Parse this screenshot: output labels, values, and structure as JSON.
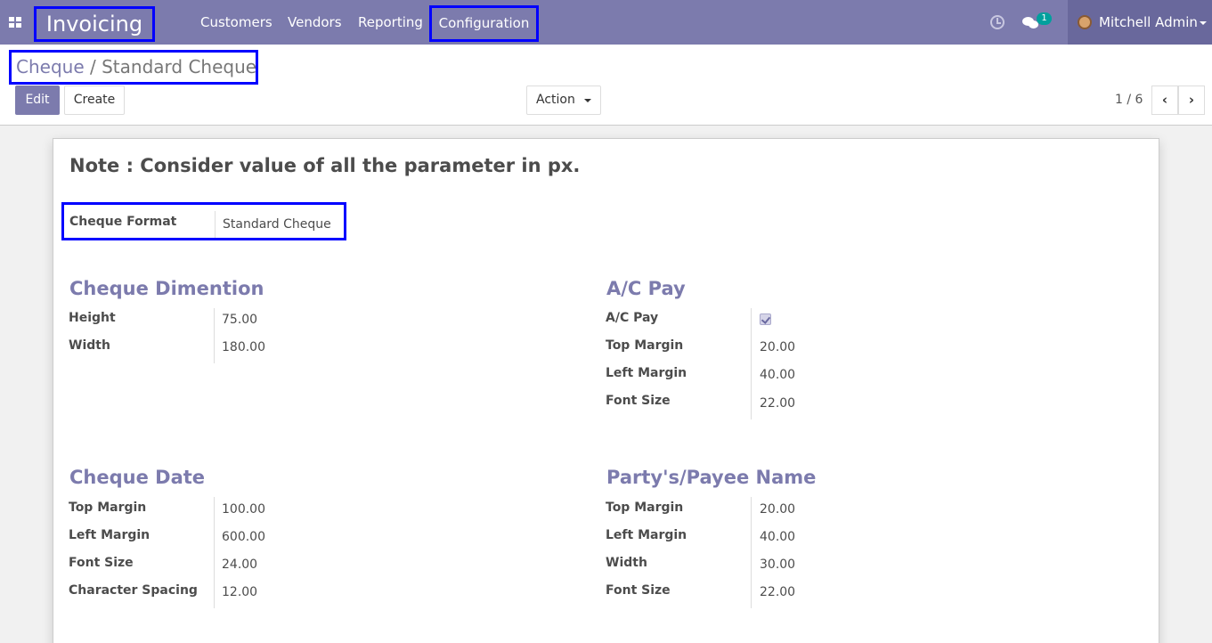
{
  "navbar": {
    "brand": "Invoicing",
    "menu": [
      "Customers",
      "Vendors",
      "Reporting",
      "Configuration"
    ],
    "chat_count": "1",
    "user_name": "Mitchell Admin"
  },
  "breadcrumb": {
    "parent": "Cheque",
    "separator": "/",
    "current": "Standard Cheque"
  },
  "buttons": {
    "edit": "Edit",
    "create": "Create",
    "action": "Action"
  },
  "pager": {
    "value": "1 / 6",
    "prev": "‹",
    "next": "›"
  },
  "form": {
    "note": "Note : Consider value of all the parameter in px.",
    "cheque_format": {
      "label": "Cheque Format",
      "value": "Standard Cheque"
    },
    "groups": {
      "dimension": {
        "title": "Cheque Dimention",
        "fields": [
          {
            "label": "Height",
            "value": "75.00"
          },
          {
            "label": "Width",
            "value": "180.00"
          }
        ]
      },
      "ac_pay": {
        "title": "A/C Pay",
        "checkbox_label": "A/C Pay",
        "checked": true,
        "fields": [
          {
            "label": "Top Margin",
            "value": "20.00"
          },
          {
            "label": "Left Margin",
            "value": "40.00"
          },
          {
            "label": "Font Size",
            "value": "22.00"
          }
        ]
      },
      "date": {
        "title": "Cheque Date",
        "fields": [
          {
            "label": "Top Margin",
            "value": "100.00"
          },
          {
            "label": "Left Margin",
            "value": "600.00"
          },
          {
            "label": "Font Size",
            "value": "24.00"
          },
          {
            "label": "Character Spacing",
            "value": "12.00"
          }
        ]
      },
      "payee": {
        "title": "Party's/Payee Name",
        "fields": [
          {
            "label": "Top Margin",
            "value": "20.00"
          },
          {
            "label": "Left Margin",
            "value": "40.00"
          },
          {
            "label": "Width",
            "value": "30.00"
          },
          {
            "label": "Font Size",
            "value": "22.00"
          }
        ]
      }
    }
  }
}
